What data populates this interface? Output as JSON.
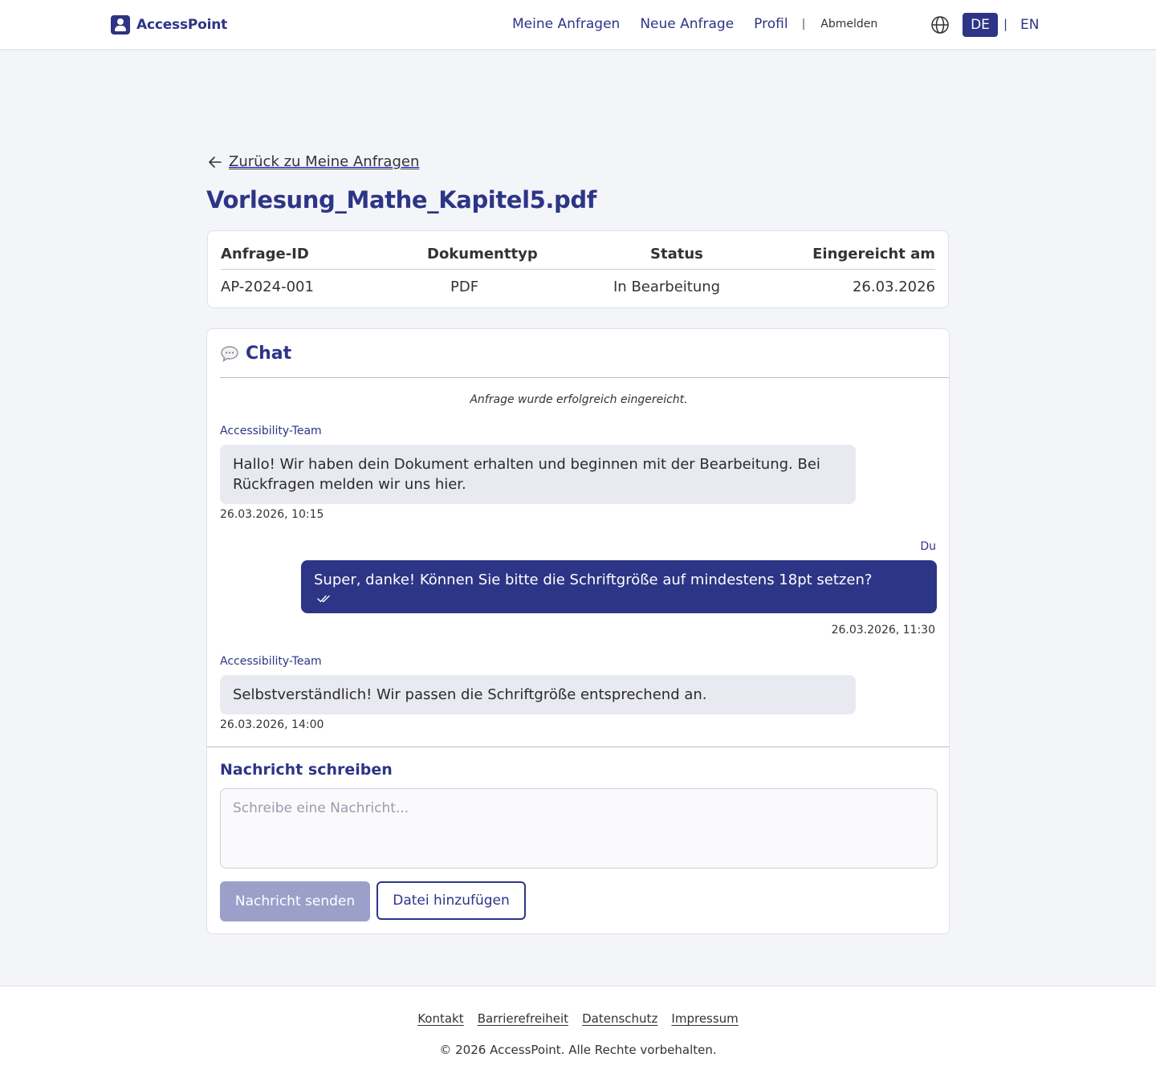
{
  "header": {
    "brand": "AccessPoint",
    "nav": {
      "my_requests": "Meine Anfragen",
      "new_request": "Neue Anfrage",
      "profile": "Profil",
      "separator": "|",
      "logout": "Abmelden"
    },
    "language": {
      "active": "DE",
      "separator": "|",
      "other": "EN"
    }
  },
  "main": {
    "back_link": "Zurück zu Meine Anfragen",
    "document_title": "Vorlesung_Mathe_Kapitel5.pdf",
    "info_table": {
      "headers": [
        "Anfrage-ID",
        "Dokumenttyp",
        "Status",
        "Eingereicht am"
      ],
      "values": [
        "AP-2024-001",
        "PDF",
        "In Bearbeitung",
        "26.03.2026"
      ]
    },
    "chat": {
      "title": "Chat",
      "system_message": "Anfrage wurde erfolgreich eingereicht.",
      "messages": [
        {
          "sender": "Accessibility-Team",
          "text": "Hallo! Wir haben dein Dokument erhalten und beginnen mit der Bearbeitung. Bei Rückfragen melden wir uns hier.",
          "timestamp": "26.03.2026, 10:15"
        },
        {
          "sender": "Du",
          "text": "Super, danke! Können Sie bitte die Schriftgröße auf mindestens 18pt setzen?",
          "timestamp": "26.03.2026, 11:30",
          "read": true
        },
        {
          "sender": "Accessibility-Team",
          "text": "Selbstverständlich! Wir passen die Schriftgröße entsprechend an.",
          "timestamp": "26.03.2026, 14:00"
        }
      ],
      "compose": {
        "title": "Nachricht schreiben",
        "placeholder": "Schreibe eine Nachricht...",
        "value": "",
        "send_label": "Nachricht senden",
        "attach_label": "Datei hinzufügen"
      }
    }
  },
  "footer": {
    "links": [
      "Kontakt",
      "Barrierefreiheit",
      "Datenschutz",
      "Impressum"
    ],
    "copyright": "© 2026 AccessPoint. Alle Rechte vorbehalten."
  },
  "colors": {
    "brand": "#2d3586",
    "incoming_bubble": "#e9eaf1",
    "disabled_button": "#9ba0cb",
    "page_background": "#f4f5f9"
  },
  "icons": {
    "brand": "user-badge-icon",
    "language": "globe-icon",
    "back": "arrow-left-icon",
    "chat": "speech-bubble-icon",
    "read_receipt": "double-check-icon"
  }
}
